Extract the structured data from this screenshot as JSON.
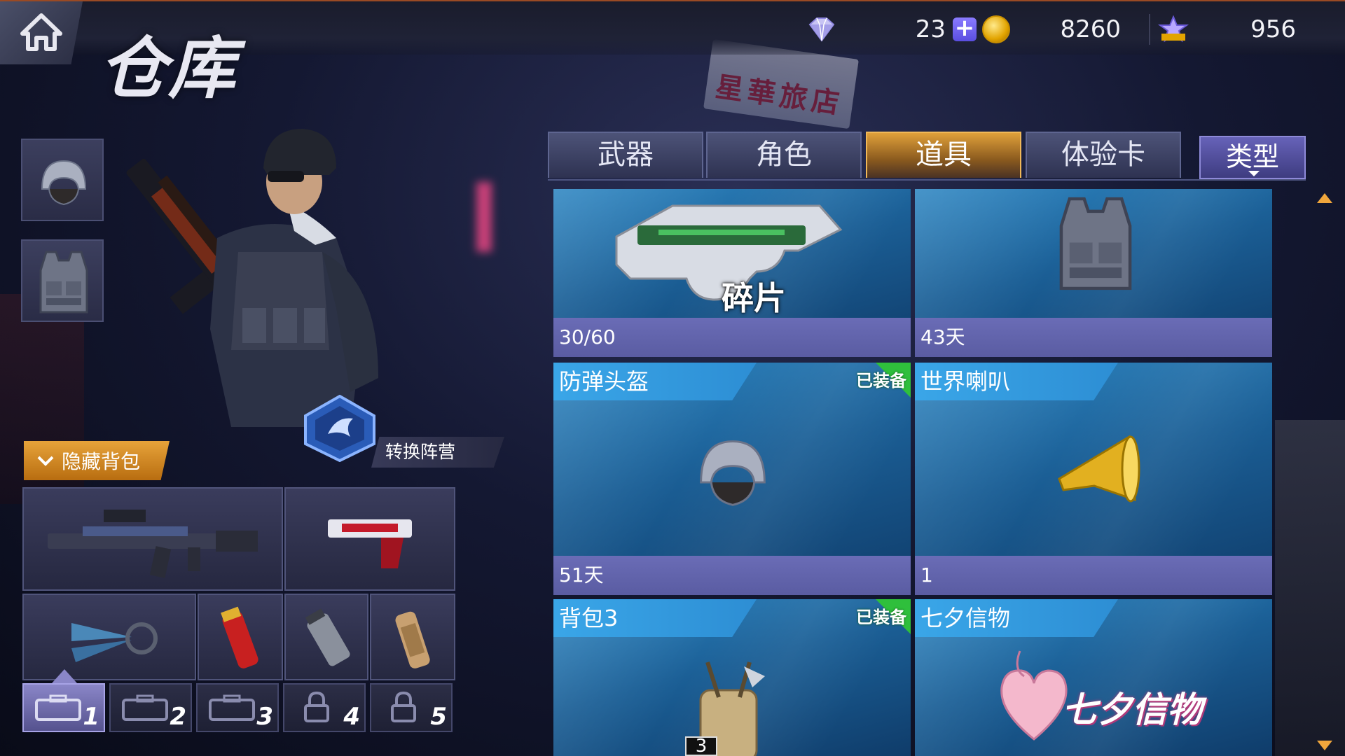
{
  "header": {
    "title": "仓库",
    "currencies": {
      "diamonds": "23",
      "coins": "8260",
      "points": "956"
    }
  },
  "equipment_slots": [
    {
      "name": "helmet"
    },
    {
      "name": "vest"
    }
  ],
  "hide_backpack_label": "隐藏背包",
  "switch_faction_label": "转换阵营",
  "bag_tabs": [
    {
      "label": "1",
      "locked": false,
      "active": true
    },
    {
      "label": "2",
      "locked": false,
      "active": false
    },
    {
      "label": "3",
      "locked": false,
      "active": false
    },
    {
      "label": "4",
      "locked": true,
      "active": false
    },
    {
      "label": "5",
      "locked": true,
      "active": false
    }
  ],
  "tabs": [
    {
      "label": "武器",
      "active": false
    },
    {
      "label": "角色",
      "active": false
    },
    {
      "label": "道具",
      "active": true
    },
    {
      "label": "体验卡",
      "active": false
    }
  ],
  "type_filter_label": "类型",
  "items": [
    {
      "name": "",
      "image_label": "碎片",
      "footer": "30/60",
      "equipped": false
    },
    {
      "name": "",
      "footer": "43天",
      "equipped": false
    },
    {
      "name": "防弹头盔",
      "footer": "51天",
      "equipped": true,
      "equipped_label": "已装备"
    },
    {
      "name": "世界喇叭",
      "footer": "1",
      "equipped": false
    },
    {
      "name": "背包3",
      "footer": "",
      "equipped": true,
      "equipped_label": "已装备",
      "count_badge": "3"
    },
    {
      "name": "七夕信物",
      "image_label": "七夕信物",
      "footer": "",
      "equipped": false
    }
  ],
  "colors": {
    "active_tab": "#e0a03a",
    "equipped_badge": "#2fbf3c",
    "card_blue": "#2e86c2",
    "footer_purple": "#6a6cb6"
  }
}
